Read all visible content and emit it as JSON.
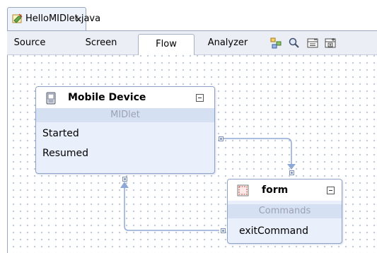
{
  "editor_tab": {
    "label": "HelloMIDlet.java",
    "close_glyph": "×",
    "icon": "java-file-icon"
  },
  "views": {
    "source": "Source",
    "screen": "Screen",
    "flow": "Flow",
    "analyzer": "Analyzer",
    "selected": "Flow"
  },
  "toolbar_icons": [
    "layout-icon",
    "zoom-icon",
    "collapse-all-icon",
    "expand-all-icon"
  ],
  "nodes": {
    "mobile_device": {
      "title": "Mobile Device",
      "subtitle": "MIDlet",
      "rows": [
        "Started",
        "Resumed"
      ],
      "icon": "device-icon"
    },
    "form": {
      "title": "form",
      "subtitle": "Commands",
      "rows": [
        "exitCommand"
      ],
      "icon": "form-icon"
    }
  },
  "colors": {
    "connector": "#8ea8d8",
    "node_bg": "#eaf0fb",
    "subtitle_band": "#d6e0f3"
  }
}
